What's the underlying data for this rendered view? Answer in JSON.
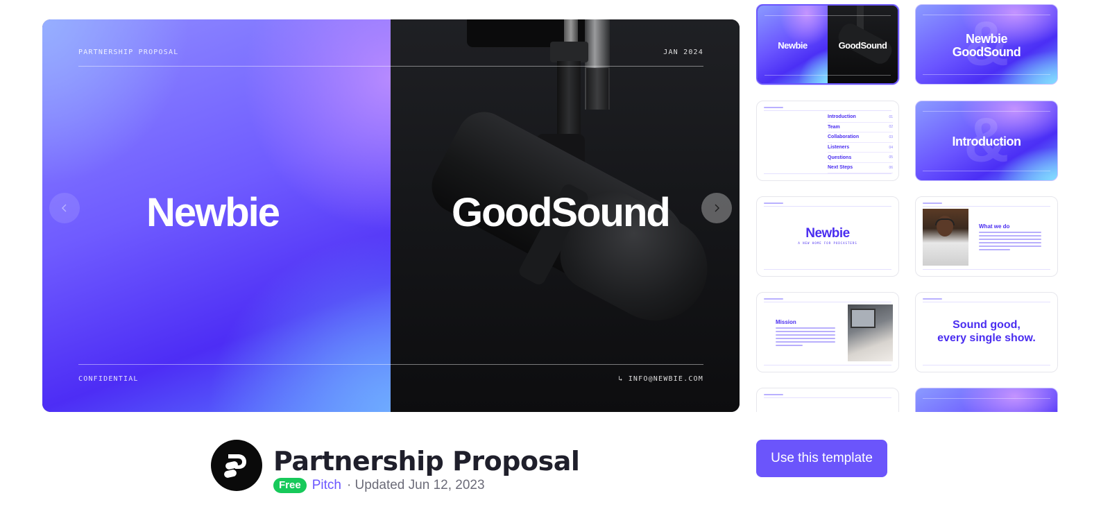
{
  "preview": {
    "top_left_label": "PARTNERSHIP PROPOSAL",
    "top_right_label": "JAN 2024",
    "bottom_left_label": "CONFIDENTIAL",
    "bottom_right_label": "↳ INFO@NEWBIE.COM",
    "brand_left": "Newbie",
    "brand_right": "GoodSound",
    "prev_icon": "chevron-left-icon",
    "next_icon": "chevron-right-icon"
  },
  "thumbnails": [
    {
      "type": "cover",
      "left": "Newbie",
      "right": "GoodSound",
      "selected": true
    },
    {
      "type": "gradient-title",
      "line1": "Newbie",
      "line2": "GoodSound"
    },
    {
      "type": "agenda",
      "items": [
        {
          "label": "Introduction",
          "num": "01"
        },
        {
          "label": "Team",
          "num": "02"
        },
        {
          "label": "Collaboration",
          "num": "03"
        },
        {
          "label": "Listeners",
          "num": "04"
        },
        {
          "label": "Questions",
          "num": "05"
        },
        {
          "label": "Next Steps",
          "num": "06"
        }
      ]
    },
    {
      "type": "gradient-title",
      "line1": "Introduction"
    },
    {
      "type": "logo",
      "title": "Newbie",
      "subtitle": "A NEW HOME FOR PODCASTERS"
    },
    {
      "type": "image-text",
      "heading": "What we do"
    },
    {
      "type": "text-image",
      "heading": "Mission"
    },
    {
      "type": "quote",
      "line1": "Sound good,",
      "line2": "every single show."
    }
  ],
  "template": {
    "title": "Partnership Proposal",
    "badge": "Free",
    "author": "Pitch",
    "updated": "· Updated Jun 12, 2023",
    "cta_label": "Use this template"
  },
  "colors": {
    "accent": "#6b55fb",
    "badge_green": "#17c95a",
    "thumb_text_purple": "#4a2df0"
  }
}
